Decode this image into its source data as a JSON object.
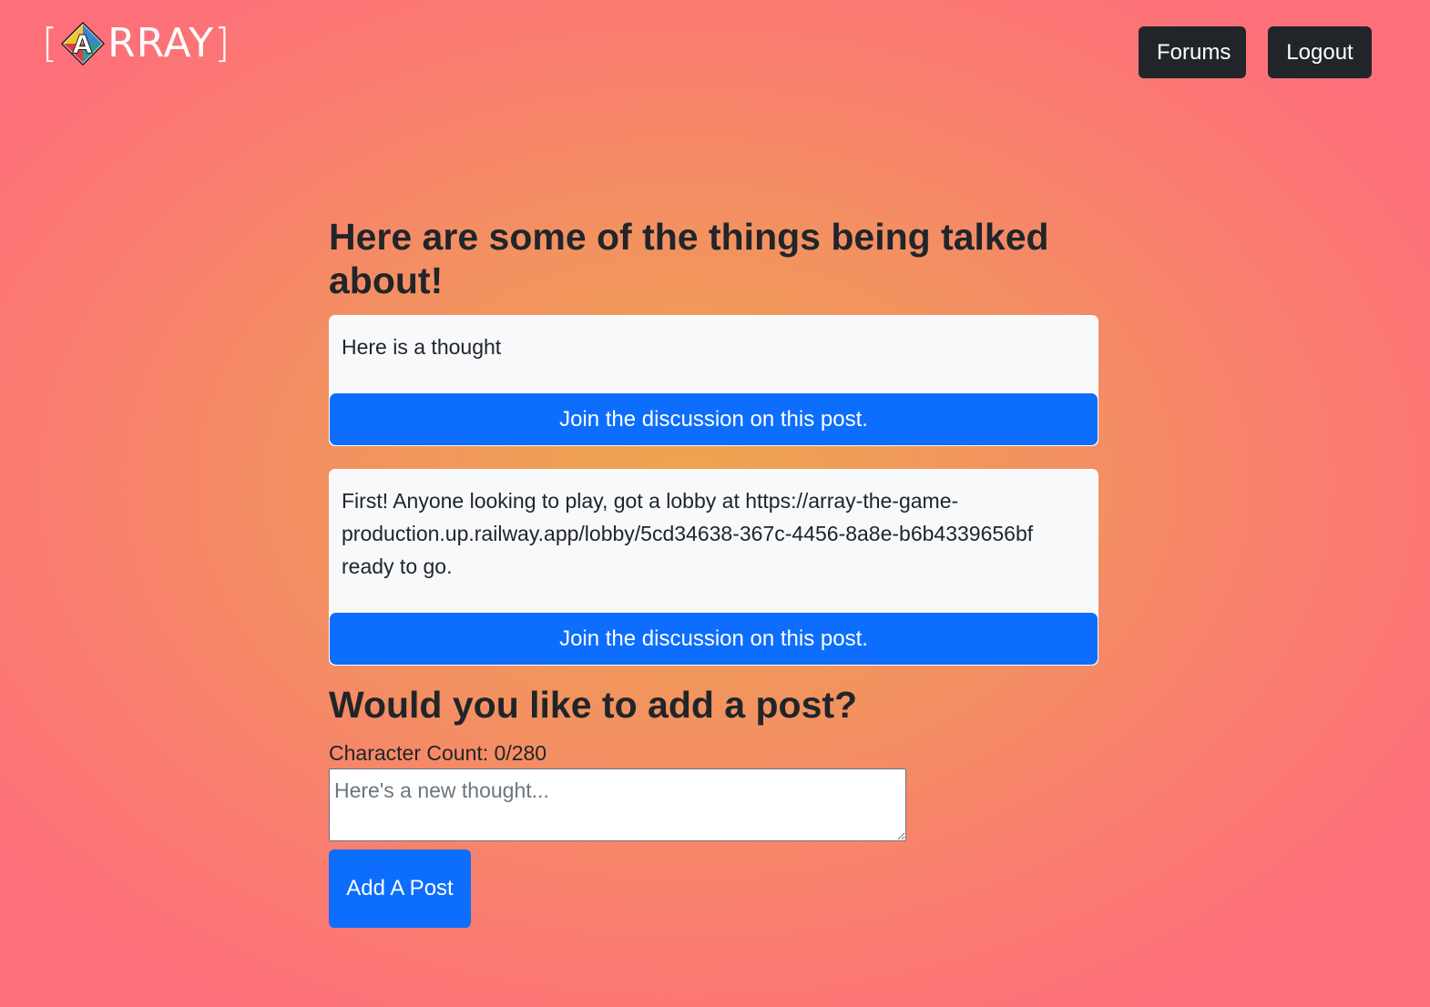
{
  "nav": {
    "logo_left_bracket": "[",
    "logo_mark_letter": "A",
    "logo_text": "RRAY",
    "logo_right_bracket": "]",
    "forums_label": "Forums",
    "logout_label": "Logout"
  },
  "main": {
    "title": "Here are some of the things being talked about!",
    "posts": [
      {
        "text": "Here is a thought",
        "button_label": "Join the discussion on this post."
      },
      {
        "text": "First! Anyone looking to play, got a lobby at https://array-the-game-production.up.railway.app/lobby/5cd34638-367c-4456-8a8e-b6b4339656bf ready to go.",
        "button_label": "Join the discussion on this post."
      }
    ]
  },
  "add_post": {
    "title": "Would you like to add a post?",
    "char_count_label": "Character Count:",
    "char_count_value": "0/280",
    "input_placeholder": "Here's a new thought...",
    "input_value": "",
    "submit_label": "Add A Post"
  },
  "colors": {
    "primary": "#0d6efd",
    "dark": "#212529",
    "card_bg": "#f8f9fa",
    "gradient_center": "#eda54e",
    "gradient_edge": "#fd7079",
    "logo_red": "#e63946",
    "logo_yellow": "#f4c430",
    "logo_green": "#2a9d8f",
    "logo_blue": "#3a86c8"
  },
  "icons": {
    "logo_mark": "diamond-logo-icon"
  }
}
